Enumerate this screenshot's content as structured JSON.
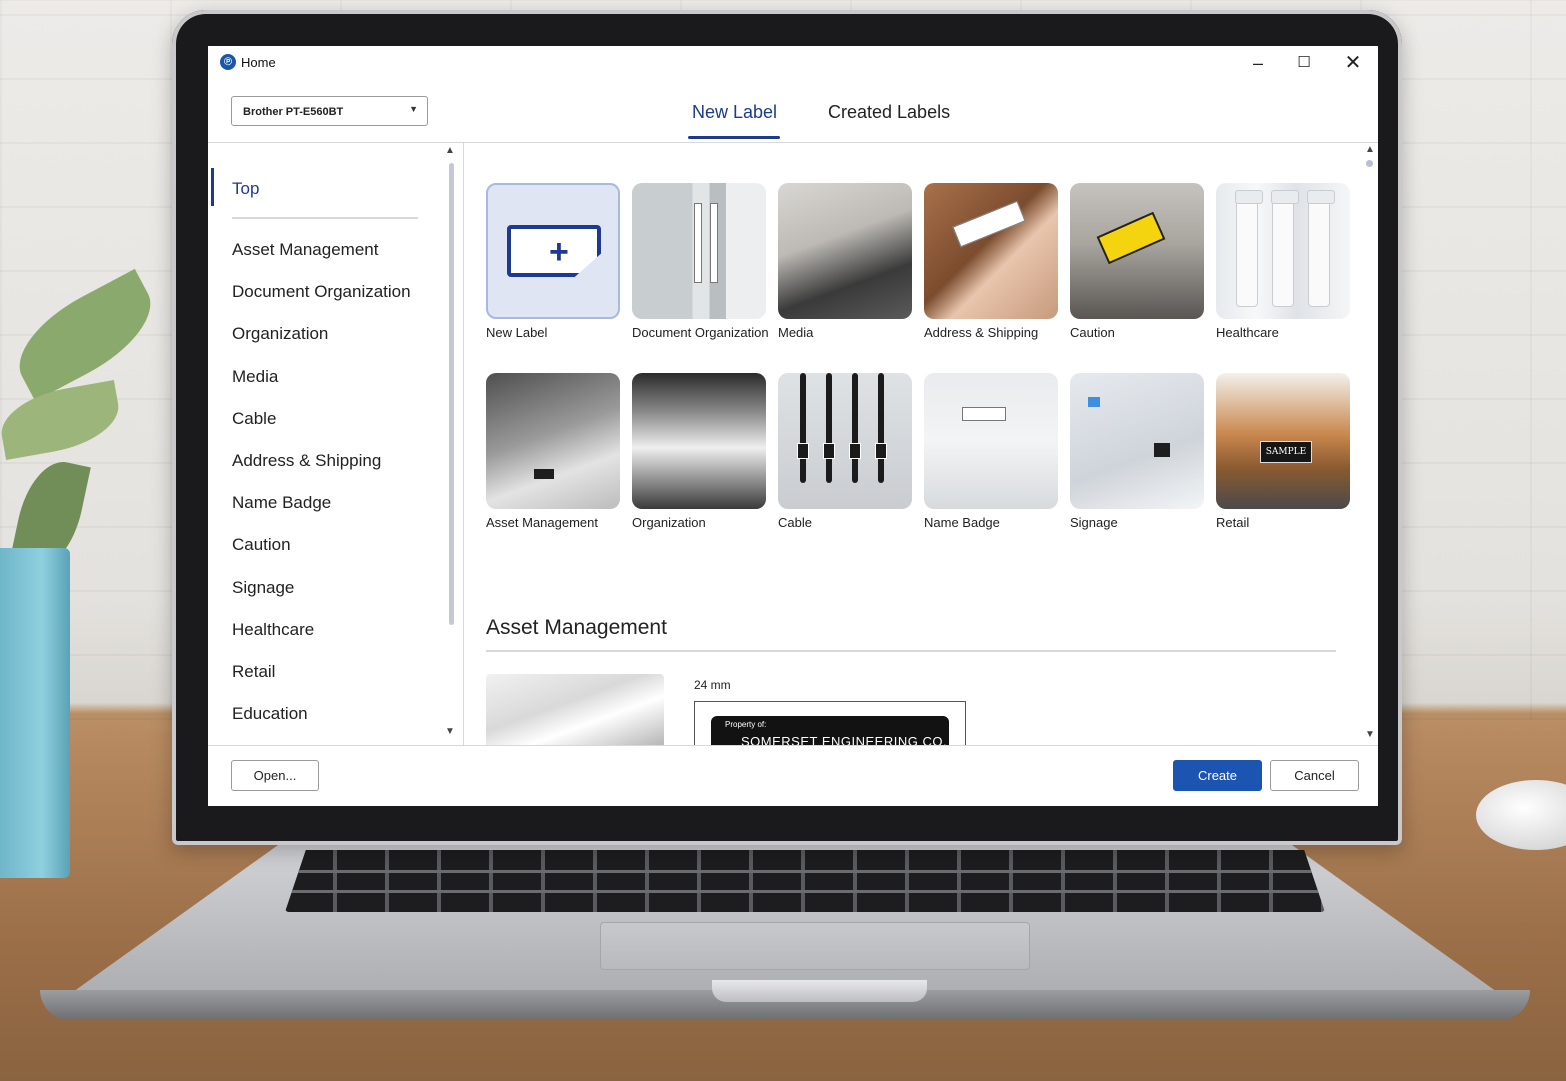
{
  "window": {
    "title": "Home",
    "minimize_glyph": "–",
    "maximize_glyph": "☐",
    "close_glyph": "✕"
  },
  "printer": {
    "selected": "Brother PT-E560BT",
    "arrow_glyph": "▼"
  },
  "tabs": [
    {
      "label": "New Label",
      "active": true
    },
    {
      "label": "Created Labels",
      "active": false
    }
  ],
  "sidebar": {
    "active": "Top",
    "items": [
      "Asset Management",
      "Document Organization",
      "Organization",
      "Media",
      "Cable",
      "Address & Shipping",
      "Name Badge",
      "Caution",
      "Signage",
      "Healthcare",
      "Retail",
      "Education"
    ]
  },
  "categories": [
    {
      "label": "New Label",
      "icon": "new-label-icon"
    },
    {
      "label": "Document Organization"
    },
    {
      "label": "Media"
    },
    {
      "label": "Address & Shipping"
    },
    {
      "label": "Caution"
    },
    {
      "label": "Healthcare"
    },
    {
      "label": "Asset Management"
    },
    {
      "label": "Organization"
    },
    {
      "label": "Cable"
    },
    {
      "label": "Name Badge"
    },
    {
      "label": "Signage"
    },
    {
      "label": "Retail"
    }
  ],
  "thumbnail_text": {
    "retail_tag": "SAMPLE"
  },
  "section": {
    "title": "Asset Management",
    "template_size": "24 mm",
    "label_small": "Property of:",
    "label_big": "SOMERSET ENGINEERING CO."
  },
  "footer": {
    "open": "Open...",
    "create": "Create",
    "cancel": "Cancel"
  },
  "colors": {
    "accent": "#1d3a8f",
    "create_button": "#1c55b1"
  }
}
